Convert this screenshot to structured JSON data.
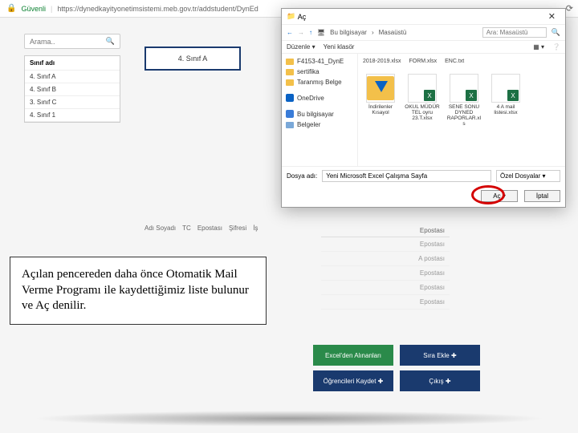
{
  "browser": {
    "secure_label": "Güvenli",
    "url": "https://dynedkayityonetimsistemi.meb.gov.tr/addstudent/DynEd"
  },
  "left": {
    "search_placeholder": "Arama..",
    "list_header": "Sınıf adı",
    "items": [
      "4. Sınıf A",
      "4. Sınıf B",
      "3. Sınıf C",
      "4. Sınıf 1"
    ]
  },
  "class_box": "4. Sınıf A",
  "table": {
    "headers": [
      "Adı Soyadı",
      "TC",
      "Epostası",
      "Şifresi",
      "İş"
    ],
    "eposta_header": "Epostası",
    "rows": [
      "Epostası",
      "A postası",
      "Epostası",
      "Epostası",
      "Epostası"
    ]
  },
  "callout": "Açılan pencereden daha önce Otomatik Mail Verme Programı ile kaydettiğimiz liste bulunur ve Aç denilir.",
  "buttons": {
    "excel": "Excel'den Alınanları",
    "excel2": "Öğrencileri Kaydet ve ✚",
    "sira": "Sıra Ekle ✚",
    "kaydet": "Öğrencileri Kaydet ✚",
    "cikis": "Çıkış ✚"
  },
  "dialog": {
    "title": "Aç",
    "path_seg1": "Bu bilgisayar",
    "path_seg2": "Masaüstü",
    "search_placeholder": "Ara: Masaüstü",
    "toolbar_org": "Düzenle ▾",
    "toolbar_new": "Yeni klasör",
    "side": [
      {
        "icon": "folder",
        "label": "F4153-41_DynE"
      },
      {
        "icon": "folder",
        "label": "sertifika"
      },
      {
        "icon": "folder",
        "label": "Taranmış Belge"
      },
      {
        "icon": "drive",
        "label": "OneDrive"
      },
      {
        "icon": "drive",
        "label": "Bu bilgisayar"
      },
      {
        "icon": "folder",
        "label": "Belgeler"
      }
    ],
    "head_files": [
      "2018-2019.xlsx",
      "FORM.xlsx",
      "ENC.txt"
    ],
    "files": [
      {
        "type": "dl",
        "label": "İndirilenler Kısayol"
      },
      {
        "type": "xl",
        "label": "OKUL MÜDÜR TEL oyru 23.T.xlsx"
      },
      {
        "type": "xl",
        "label": "SENE SONU DYNED RAPORLAR.xls"
      },
      {
        "type": "xl",
        "label": "4 A mail listesi.xlsx"
      }
    ],
    "filename_label": "Dosya adı:",
    "filename_value": "Yeni Microsoft Excel Çalışma Sayfa",
    "filter": "Özel Dosyalar",
    "open": "Aç",
    "cancel": "İptal"
  }
}
